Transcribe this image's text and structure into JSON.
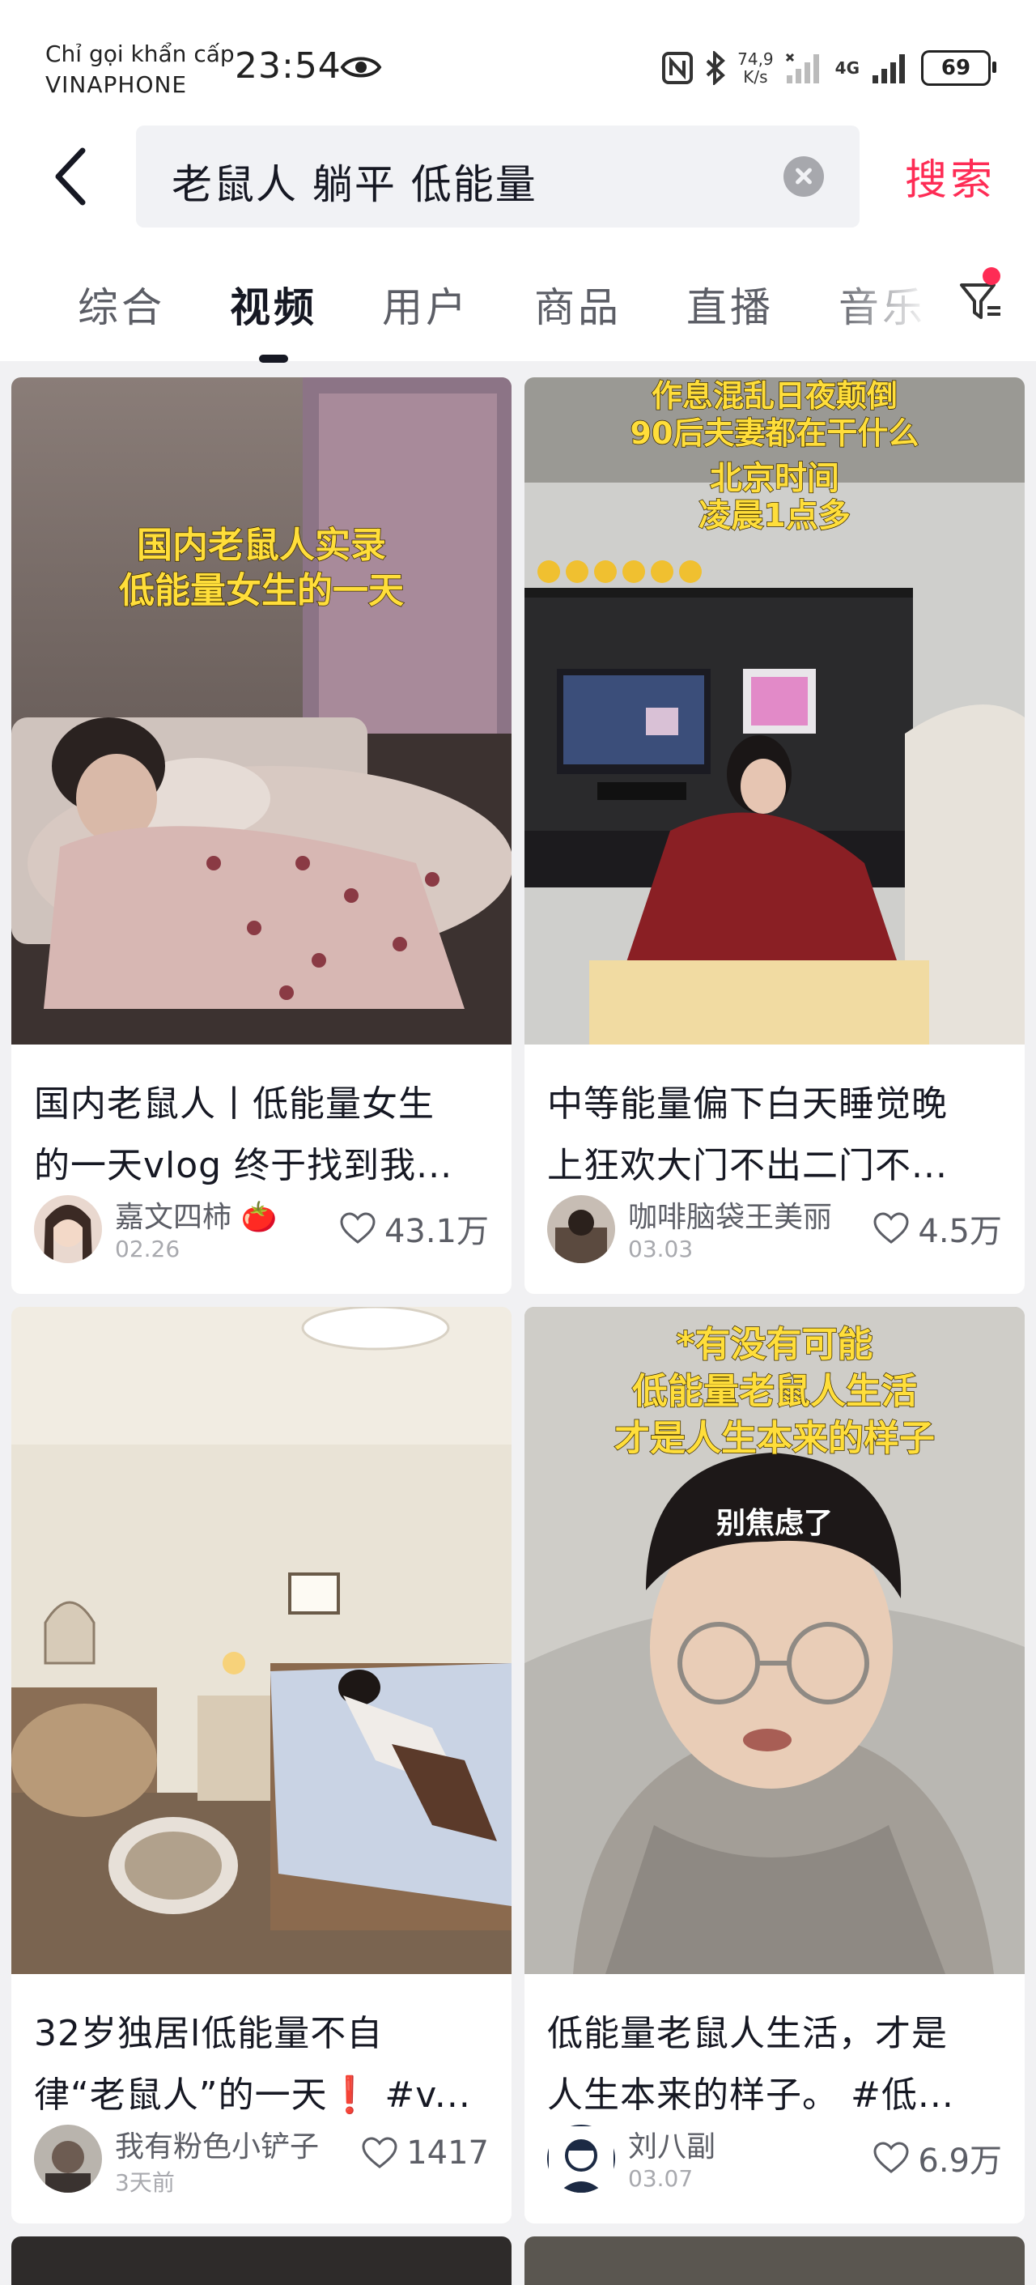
{
  "status_bar": {
    "carrier_line1": "Chỉ gọi khẩn cấp",
    "carrier_line2": "VINAPHONE",
    "time": "23:54",
    "speed_value": "74,9",
    "speed_unit": "K/s",
    "network": "4G",
    "battery": "69"
  },
  "search": {
    "query": "老鼠人 躺平 低能量",
    "button": "搜索"
  },
  "tabs": [
    "综合",
    "视频",
    "用户",
    "商品",
    "直播",
    "音乐"
  ],
  "active_tab": "视频",
  "results": [
    {
      "overlay": [
        "国内老鼠人实录",
        "低能量女生的一天"
      ],
      "title_lines": [
        "国内老鼠人丨低能量女生",
        "的一天vlog 终于找到我..."
      ],
      "author": "嘉文四柿 🍅",
      "date": "02.26",
      "likes": "43.1万"
    },
    {
      "overlay": [
        "作息混乱日夜颠倒",
        "90后夫妻都在干什么",
        "北京时间",
        "凌晨1点多"
      ],
      "title_lines": [
        "中等能量偏下白天睡觉晚",
        "上狂欢大门不出二门不..."
      ],
      "author": "咖啡脑袋王美丽",
      "date": "03.03",
      "likes": "4.5万"
    },
    {
      "overlay": [],
      "title_lines": [
        "32岁独居l低能量不自",
        "律“老鼠人”的一天❗ #v..."
      ],
      "author": "我有粉色小铲子",
      "date": "3天前",
      "likes": "1417"
    },
    {
      "overlay": [
        "*有没有可能",
        "低能量老鼠人生活",
        "才是人生本来的样子",
        "别焦虑了"
      ],
      "title_lines": [
        "低能量老鼠人生活，才是",
        "人生本来的样子。 #低..."
      ],
      "author": "刘八副",
      "date": "03.07",
      "likes": "6.9万"
    }
  ],
  "colors": {
    "accent": "#fe2c55",
    "caption_yellow": "#ffde3a",
    "page_bg": "#f1f1f3"
  },
  "icons": [
    "back-arrow-icon",
    "eye-icon",
    "nfc-icon",
    "bluetooth-icon",
    "signal-icon",
    "battery-icon",
    "clear-icon",
    "filter-icon",
    "heart-icon"
  ]
}
